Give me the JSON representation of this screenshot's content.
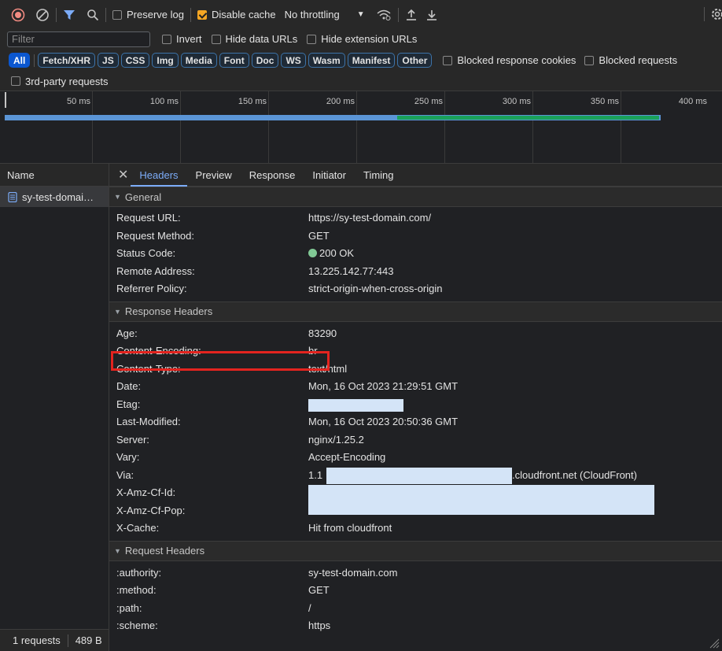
{
  "toolbar": {
    "preserve_log": "Preserve log",
    "disable_cache": "Disable cache",
    "throttling": "No throttling"
  },
  "filter": {
    "placeholder": "Filter",
    "invert": "Invert",
    "hide_data_urls": "Hide data URLs",
    "hide_extension_urls": "Hide extension URLs"
  },
  "chips": [
    "All",
    "Fetch/XHR",
    "JS",
    "CSS",
    "Img",
    "Media",
    "Font",
    "Doc",
    "WS",
    "Wasm",
    "Manifest",
    "Other"
  ],
  "blocked": {
    "cookies": "Blocked response cookies",
    "requests": "Blocked requests",
    "third_party": "3rd-party requests"
  },
  "timeline": {
    "ticks": [
      "50 ms",
      "100 ms",
      "150 ms",
      "200 ms",
      "250 ms",
      "300 ms",
      "350 ms",
      "400 ms"
    ]
  },
  "name_panel": {
    "header": "Name",
    "row": "sy-test-domai…",
    "status_requests": "1 requests",
    "status_size": "489 B"
  },
  "tabs": [
    "Headers",
    "Preview",
    "Response",
    "Initiator",
    "Timing"
  ],
  "general": {
    "title": "General",
    "rows": [
      {
        "k": "Request URL:",
        "v": "https://sy-test-domain.com/"
      },
      {
        "k": "Request Method:",
        "v": "GET"
      },
      {
        "k": "Status Code:",
        "v": "200 OK"
      },
      {
        "k": "Remote Address:",
        "v": "13.225.142.77:443"
      },
      {
        "k": "Referrer Policy:",
        "v": "strict-origin-when-cross-origin"
      }
    ]
  },
  "response_headers": {
    "title": "Response Headers",
    "rows": [
      {
        "k": "Age:",
        "v": "83290"
      },
      {
        "k": "Content-Encoding:",
        "v": "br"
      },
      {
        "k": "Content-Type:",
        "v": "text/html"
      },
      {
        "k": "Date:",
        "v": "Mon, 16 Oct 2023 21:29:51 GMT"
      },
      {
        "k": "Etag:",
        "v": ""
      },
      {
        "k": "Last-Modified:",
        "v": "Mon, 16 Oct 2023 20:50:36 GMT"
      },
      {
        "k": "Server:",
        "v": "nginx/1.25.2"
      },
      {
        "k": "Vary:",
        "v": "Accept-Encoding"
      },
      {
        "k": "Via:",
        "v": "1.1"
      },
      {
        "k": "X-Amz-Cf-Id:",
        "v": ""
      },
      {
        "k": "X-Amz-Cf-Pop:",
        "v": ""
      },
      {
        "k": "X-Cache:",
        "v": "Hit from cloudfront"
      }
    ],
    "via_suffix": ".cloudfront.net (CloudFront)"
  },
  "request_headers": {
    "title": "Request Headers",
    "rows": [
      {
        "k": ":authority:",
        "v": "sy-test-domain.com"
      },
      {
        "k": ":method:",
        "v": "GET"
      },
      {
        "k": ":path:",
        "v": "/"
      },
      {
        "k": ":scheme:",
        "v": "https"
      }
    ]
  },
  "colors": {
    "accent": "#7cacf8",
    "highlight": "#e3241f",
    "status_ok": "#81c995",
    "redaction": "#d4e4f7"
  }
}
